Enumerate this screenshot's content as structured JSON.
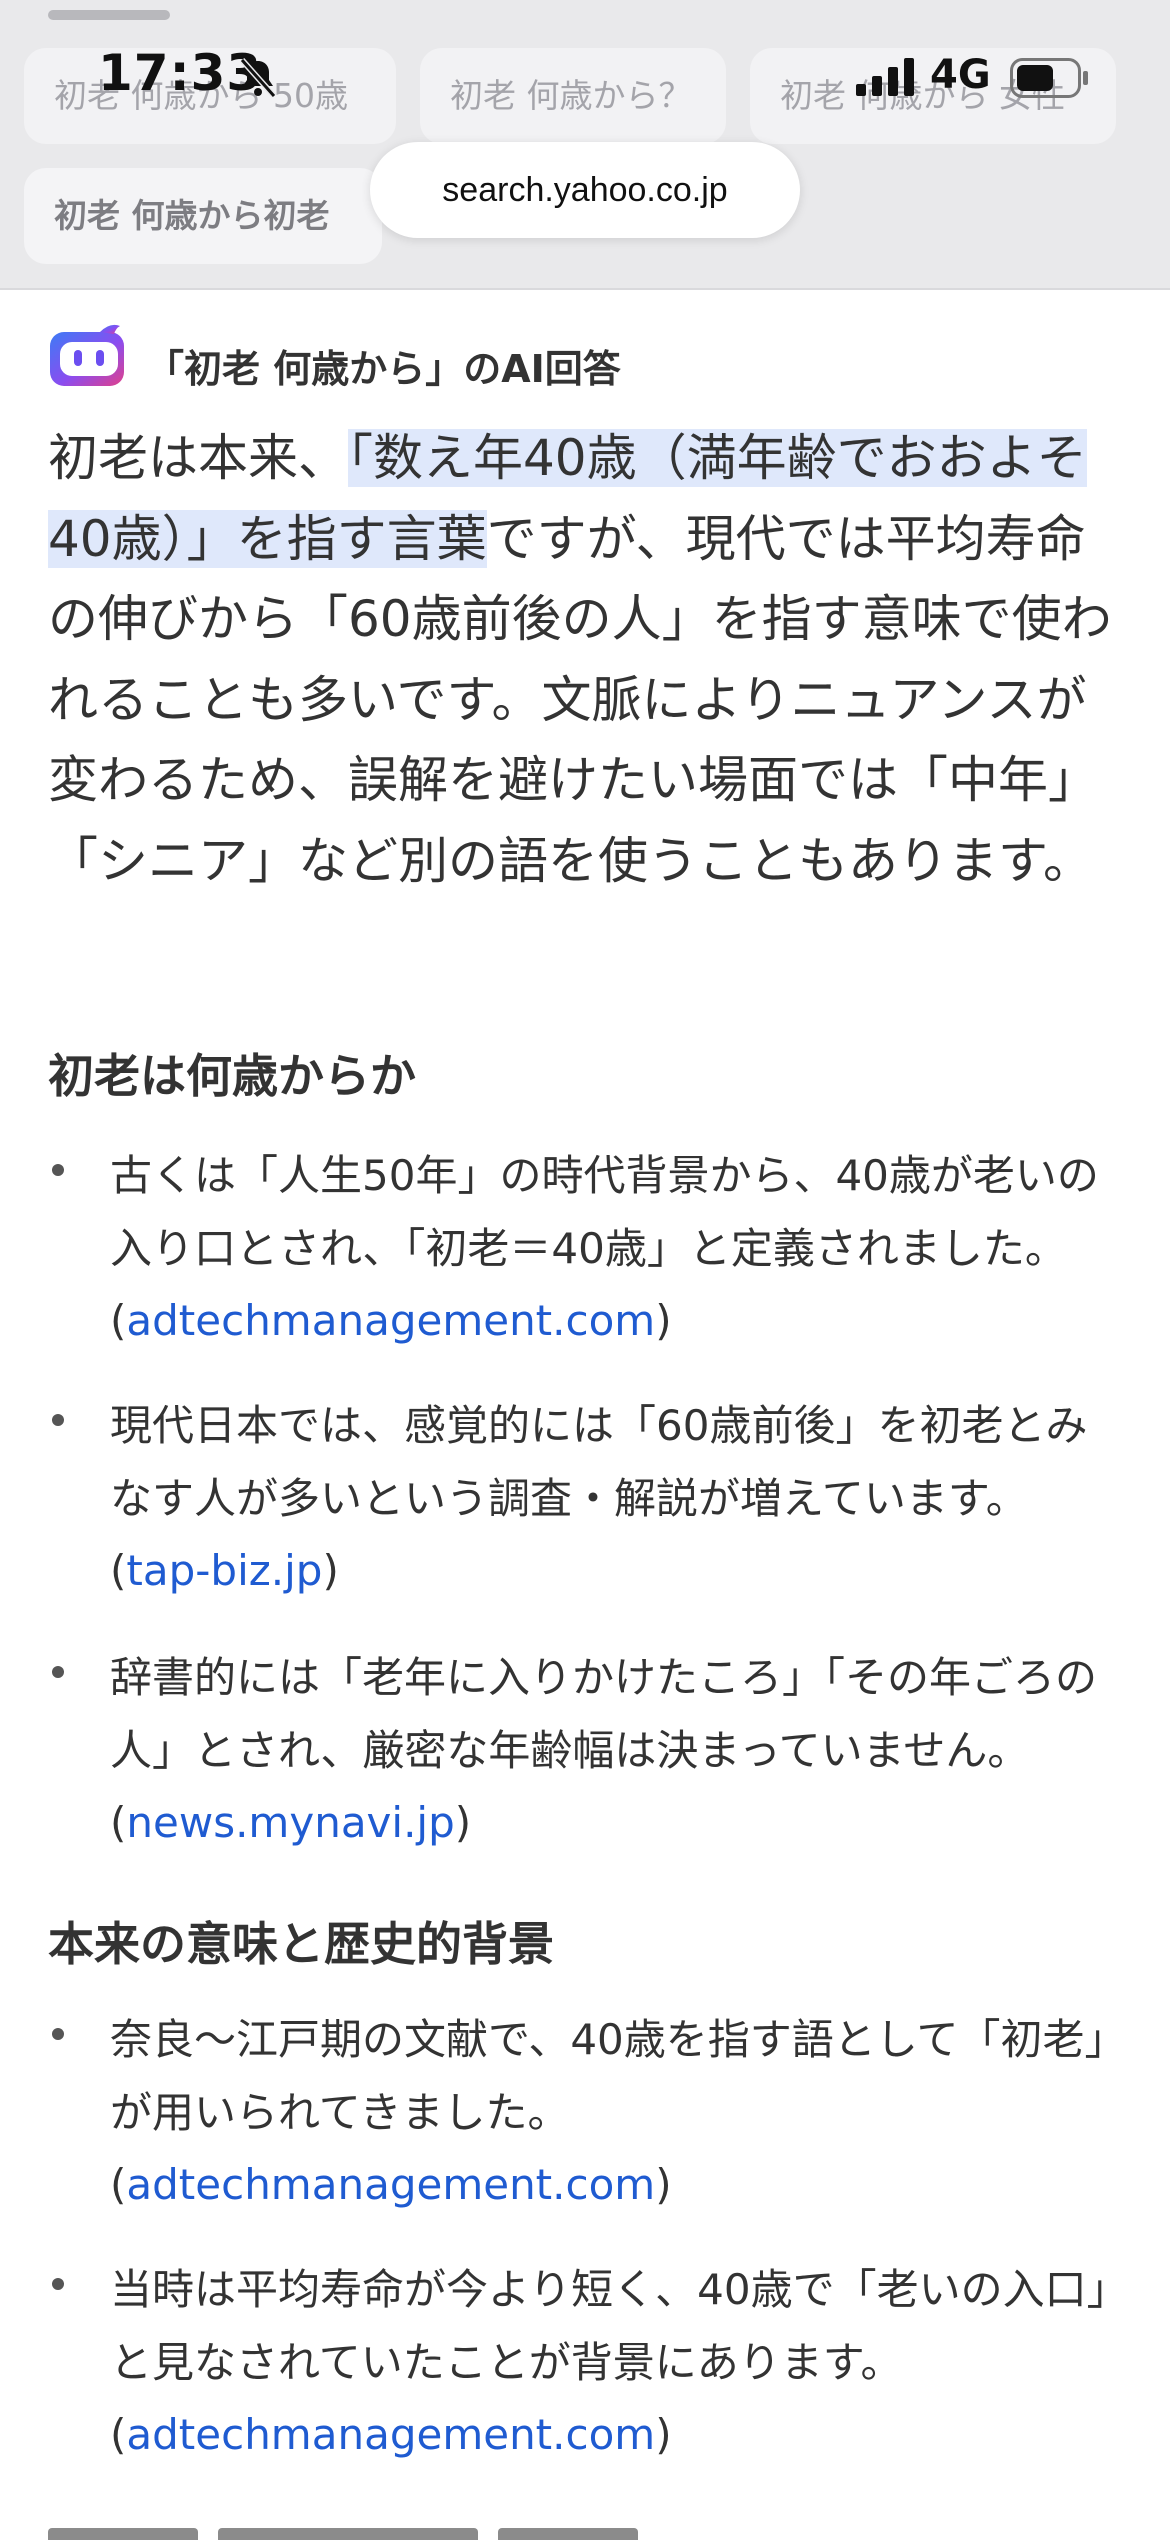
{
  "status_bar": {
    "time": "17:33",
    "network": "4G",
    "icons": [
      "bell-slash-icon",
      "signal-icon",
      "battery-icon"
    ]
  },
  "browser": {
    "url": "search.yahoo.co.jp"
  },
  "suggestion_chips": [
    "初老 何歳から 50歳",
    "初老 何歳から？",
    "初老 何歳から 女性",
    "初老 何歳から初老"
  ],
  "ai_answer": {
    "title": "「初老 何歳から」のAI回答",
    "intro_before": "初老は本来、",
    "intro_highlight": "「数え年40歳（満年齢でおおよそ40歳）」を指す言葉",
    "intro_after": "ですが、現代では平均寿命の伸びから「60歳前後の人」を指す意味で使われることも多いです。文脈によりニュアンスが変わるため、誤解を避けたい場面では「中年」「シニア」など別の語を使うこともあります。"
  },
  "section1": {
    "heading": "初老は何歳からか",
    "items": [
      {
        "text": "古くは「人生50年」の時代背景から、40歳が老いの入り口とされ、「初老＝40歳」と定義されました。",
        "source": "adtechmanagement.com"
      },
      {
        "text": "現代日本では、感覚的には「60歳前後」を初老とみなす人が多いという調査・解説が増えています。",
        "source": "tap-biz.jp"
      },
      {
        "text": "辞書的には「老年に入りかけたころ」「その年ごろの人」とされ、厳密な年齢幅は決まっていません。",
        "source": "news.mynavi.jp"
      }
    ]
  },
  "section2": {
    "heading": "本来の意味と歴史的背景",
    "items": [
      {
        "text": "奈良〜江戸期の文献で、40歳を指す語として「初老」が用いられてきました。",
        "source": "adtechmanagement.com"
      },
      {
        "text": "当時は平均寿命が今より短く、40歳で「老いの入口」と見なされていたことが背景にあります。",
        "source": "adtechmanagement.com"
      }
    ]
  },
  "colors": {
    "link": "#1f5bd1",
    "highlight": "#dfe8fb",
    "text": "#333333",
    "top_background": "#e9e9eb"
  }
}
